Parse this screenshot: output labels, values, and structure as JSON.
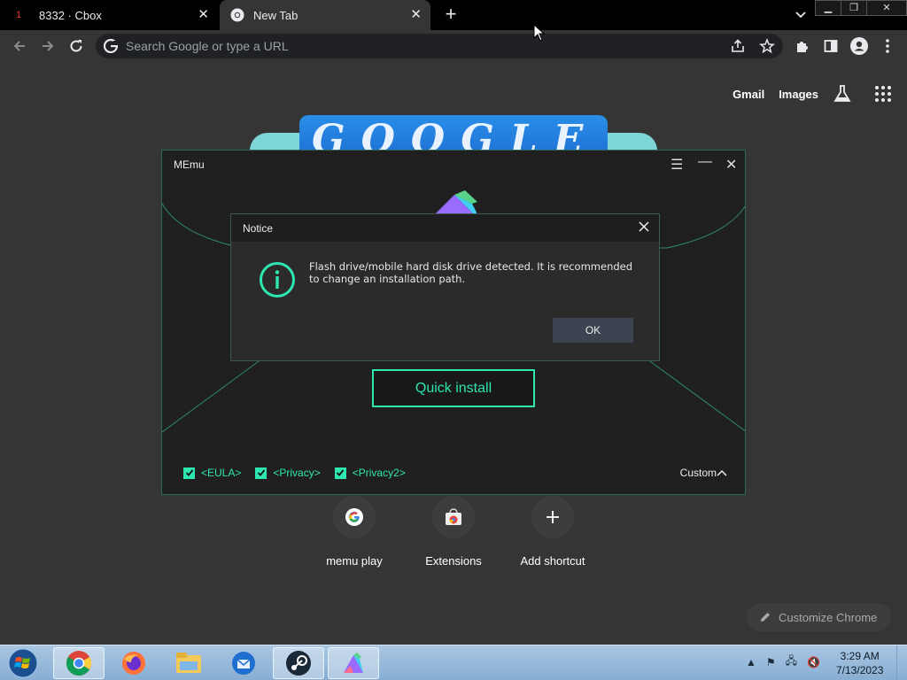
{
  "browser": {
    "tabs": [
      {
        "badge": "1",
        "title": "8332 · Cbox"
      },
      {
        "title": "New Tab"
      }
    ],
    "window_buttons": [
      "▁",
      "❐",
      "✕"
    ],
    "omnibox_placeholder": "Search Google or type a URL"
  },
  "ntp": {
    "links": {
      "gmail": "Gmail",
      "images": "Images"
    },
    "doodle_text": "GOOGLE",
    "shortcuts": [
      {
        "label": "memu play",
        "icon": "google-g-icon"
      },
      {
        "label": "Extensions",
        "icon": "chrome-webstore-icon"
      },
      {
        "label": "Add shortcut",
        "icon": "plus-icon"
      }
    ],
    "customize_label": "Customize Chrome"
  },
  "memu": {
    "title": "MEmu",
    "quick_install": "Quick install",
    "agreements": [
      "<EULA>",
      "<Privacy>",
      "<Privacy2>"
    ],
    "custom_label": "Custom",
    "accent": "#2ee6b0"
  },
  "notice": {
    "title": "Notice",
    "message": "Flash drive/mobile hard disk drive detected. It is recommended to change an installation path.",
    "ok_label": "OK"
  },
  "taskbar": {
    "apps": [
      "chrome-icon",
      "firefox-icon",
      "file-explorer-icon",
      "thunderbird-icon",
      "steam-icon",
      "memu-icon"
    ],
    "time": "3:29 AM",
    "date": "7/13/2023"
  }
}
